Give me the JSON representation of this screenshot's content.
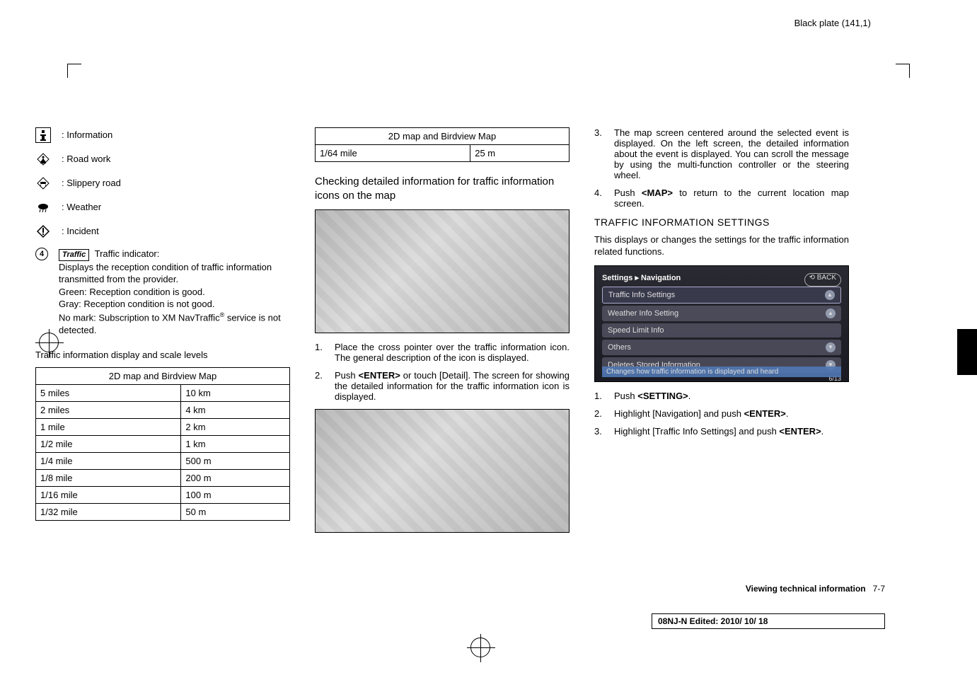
{
  "header": "Black plate (141,1)",
  "col1": {
    "icons": [
      {
        "name": "information-icon",
        "label": ": Information"
      },
      {
        "name": "roadwork-icon",
        "label": ": Road work"
      },
      {
        "name": "slippery-icon",
        "label": ": Slippery road"
      },
      {
        "name": "weather-icon",
        "label": ": Weather"
      },
      {
        "name": "incident-icon",
        "label": ": Incident"
      }
    ],
    "num": "4",
    "traffic_badge": "Traffic",
    "traffic_label": " Traffic indicator:",
    "traffic_body1": "Displays the reception condition of traffic information transmitted from the provider.",
    "traffic_body2": "Green: Reception condition is good.",
    "traffic_body3": "Gray: Reception condition is not good.",
    "traffic_body4": "No mark: Subscription to XM NavTraffic",
    "traffic_body4_sup": "®",
    "traffic_body5": " service is not detected.",
    "scale_heading": "Traffic information display and scale levels",
    "table1_header": "2D map and Birdview Map",
    "table1_rows": [
      [
        "5 miles",
        "10 km"
      ],
      [
        "2 miles",
        "4 km"
      ],
      [
        "1 mile",
        "2 km"
      ],
      [
        "1/2 mile",
        "1 km"
      ],
      [
        "1/4 mile",
        "500 m"
      ],
      [
        "1/8 mile",
        "200 m"
      ],
      [
        "1/16 mile",
        "100 m"
      ],
      [
        "1/32 mile",
        "50 m"
      ]
    ]
  },
  "col2": {
    "table2_header": "2D map and Birdview Map",
    "table2_rows": [
      [
        "1/64 mile",
        "25 m"
      ]
    ],
    "heading1": "Checking detailed information for traffic information icons on the map",
    "step1": "Place the cross pointer over the traffic information icon. The general description of the icon is displayed.",
    "step2a": "Push ",
    "step2_btn": "<ENTER>",
    "step2b": " or touch [Detail]. The screen for showing the detailed information for the traffic information icon is displayed."
  },
  "col3": {
    "step3": "The map screen centered around the selected event is displayed. On the left screen, the detailed information about the event is displayed. You can scroll the message by using the multi-function controller or the steering wheel.",
    "step4a": "Push ",
    "step4_btn": "<MAP>",
    "step4b": " to return to the current location map screen.",
    "section_heading": "TRAFFIC INFORMATION SETTINGS",
    "section_para": "This displays or changes the settings for the traffic information related functions.",
    "settings_title": "Settings ▸ Navigation",
    "settings_back": "⟲ BACK",
    "settings_items": [
      "Traffic Info Settings",
      "Weather Info Setting",
      "Speed Limit Info",
      "Others",
      "Deletes Stored Information"
    ],
    "settings_count": "6/13",
    "settings_footer": "Changes how traffic information is displayed and heard",
    "bstep1a": "Push ",
    "bstep1_btn": "<SETTING>",
    "bstep1b": ".",
    "bstep2a": "Highlight [Navigation] and push ",
    "bstep2_btn": "<ENTER>",
    "bstep2b": ".",
    "bstep3a": "Highlight [Traffic Info Settings] and push ",
    "bstep3_btn": "<ENTER>",
    "bstep3b": "."
  },
  "footer": {
    "page_label": "Viewing technical information",
    "page_num": "7-7",
    "doc_info": "08NJ-N Edited:  2010/ 10/ 18"
  }
}
